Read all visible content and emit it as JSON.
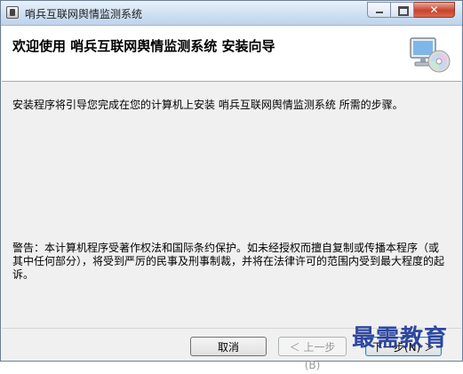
{
  "window": {
    "title": "哨兵互联网舆情监测系统",
    "caption_buttons": {
      "minimize_icon": "minimize-icon",
      "maximize_icon": "maximize-icon",
      "close_icon": "close-icon",
      "close_glyph": "✕"
    }
  },
  "header": {
    "title": "欢迎使用 哨兵互联网舆情监测系统 安装向导",
    "icon": "setup-computer-icon"
  },
  "main": {
    "intro": "安装程序将引导您完成在您的计算机上安装 哨兵互联网舆情监测系统 所需的步骤。",
    "warning": "警告：本计算机程序受著作权法和国际条约保护。如未经授权而擅自复制或传播本程序（或其中任何部分），将受到严厉的民事及刑事制裁，并将在法律许可的范围内受到最大程度的起诉。"
  },
  "buttons": {
    "cancel": "取消",
    "back": "＜ 上一步(B)",
    "next": "下一步(N) ＞"
  },
  "watermark": "最需教育",
  "colors": {
    "title_bar": "#cfe0f2",
    "close_button": "#c7422d",
    "watermark": "#1f3a9a"
  }
}
